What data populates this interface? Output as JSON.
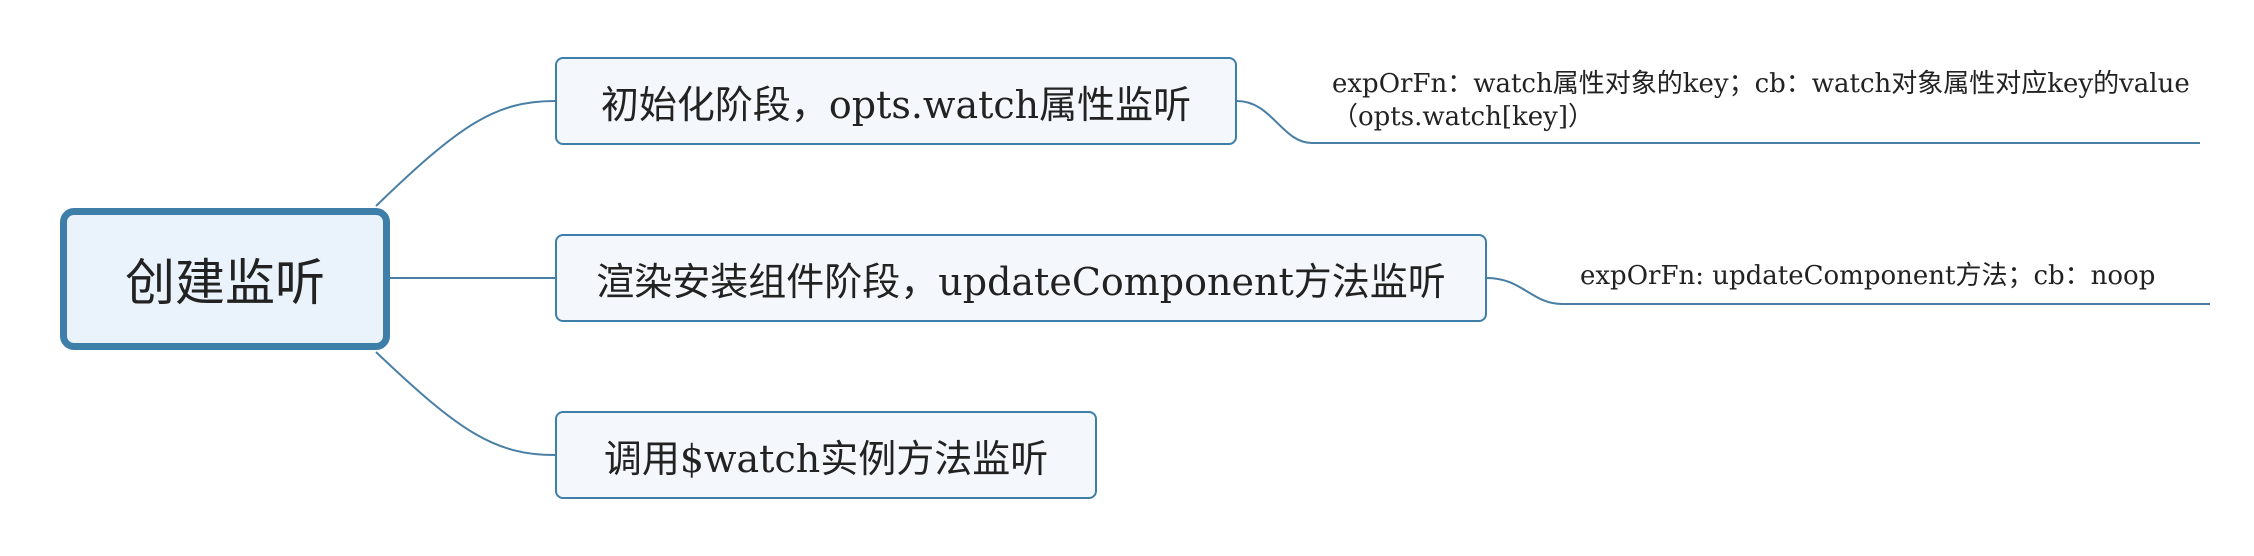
{
  "mindmap": {
    "root": {
      "label": "创建监听"
    },
    "branches": [
      {
        "label": "初始化阶段，opts.watch属性监听",
        "note": "expOrFn：watch属性对象的key；cb：watch对象属性对应key的value（opts.watch[key]）"
      },
      {
        "label": "渲染安装组件阶段，updateComponent方法监听",
        "note": "expOrFn: updateComponent方法；cb：noop"
      },
      {
        "label": "调用$watch实例方法监听"
      }
    ]
  },
  "colors": {
    "line": "#4a7fa5",
    "node_border": "#3d7fa8",
    "root_fill": "#eaf2fb",
    "branch_fill": "#f4f8fc",
    "text": "#222222"
  }
}
